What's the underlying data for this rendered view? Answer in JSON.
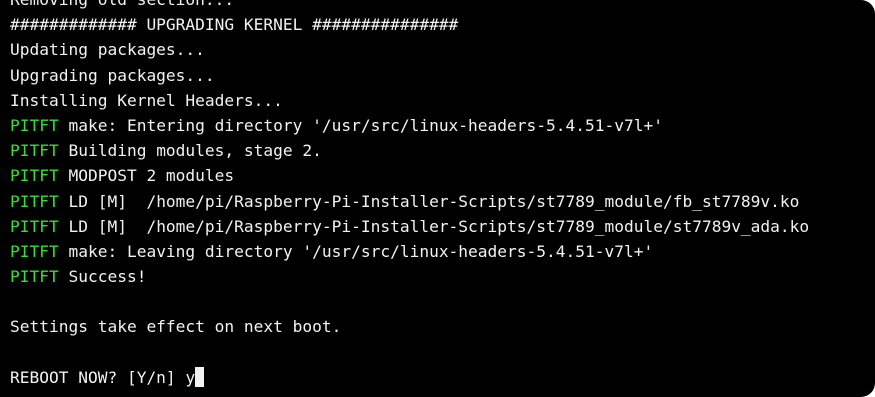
{
  "terminal": {
    "colors": {
      "background": "#000000",
      "text": "#f2f2f2",
      "prefix": "#33e033"
    },
    "lines": [
      {
        "prefix": "",
        "text": "Removing old section..."
      },
      {
        "prefix": "",
        "text": "############# UPGRADING KERNEL ###############"
      },
      {
        "prefix": "",
        "text": "Updating packages..."
      },
      {
        "prefix": "",
        "text": "Upgrading packages..."
      },
      {
        "prefix": "",
        "text": "Installing Kernel Headers..."
      },
      {
        "prefix": "PITFT",
        "text": " make: Entering directory '/usr/src/linux-headers-5.4.51-v7l+'"
      },
      {
        "prefix": "PITFT",
        "text": " Building modules, stage 2."
      },
      {
        "prefix": "PITFT",
        "text": " MODPOST 2 modules"
      },
      {
        "prefix": "PITFT",
        "text": " LD [M]  /home/pi/Raspberry-Pi-Installer-Scripts/st7789_module/fb_st7789v.ko"
      },
      {
        "prefix": "PITFT",
        "text": " LD [M]  /home/pi/Raspberry-Pi-Installer-Scripts/st7789_module/st7789v_ada.ko"
      },
      {
        "prefix": "PITFT",
        "text": " make: Leaving directory '/usr/src/linux-headers-5.4.51-v7l+'"
      },
      {
        "prefix": "PITFT",
        "text": " Success!"
      },
      {
        "prefix": "",
        "text": ""
      },
      {
        "prefix": "",
        "text": "Settings take effect on next boot."
      },
      {
        "prefix": "",
        "text": ""
      }
    ],
    "prompt": {
      "text": "REBOOT NOW? [Y/n] ",
      "input_value": "y"
    }
  }
}
